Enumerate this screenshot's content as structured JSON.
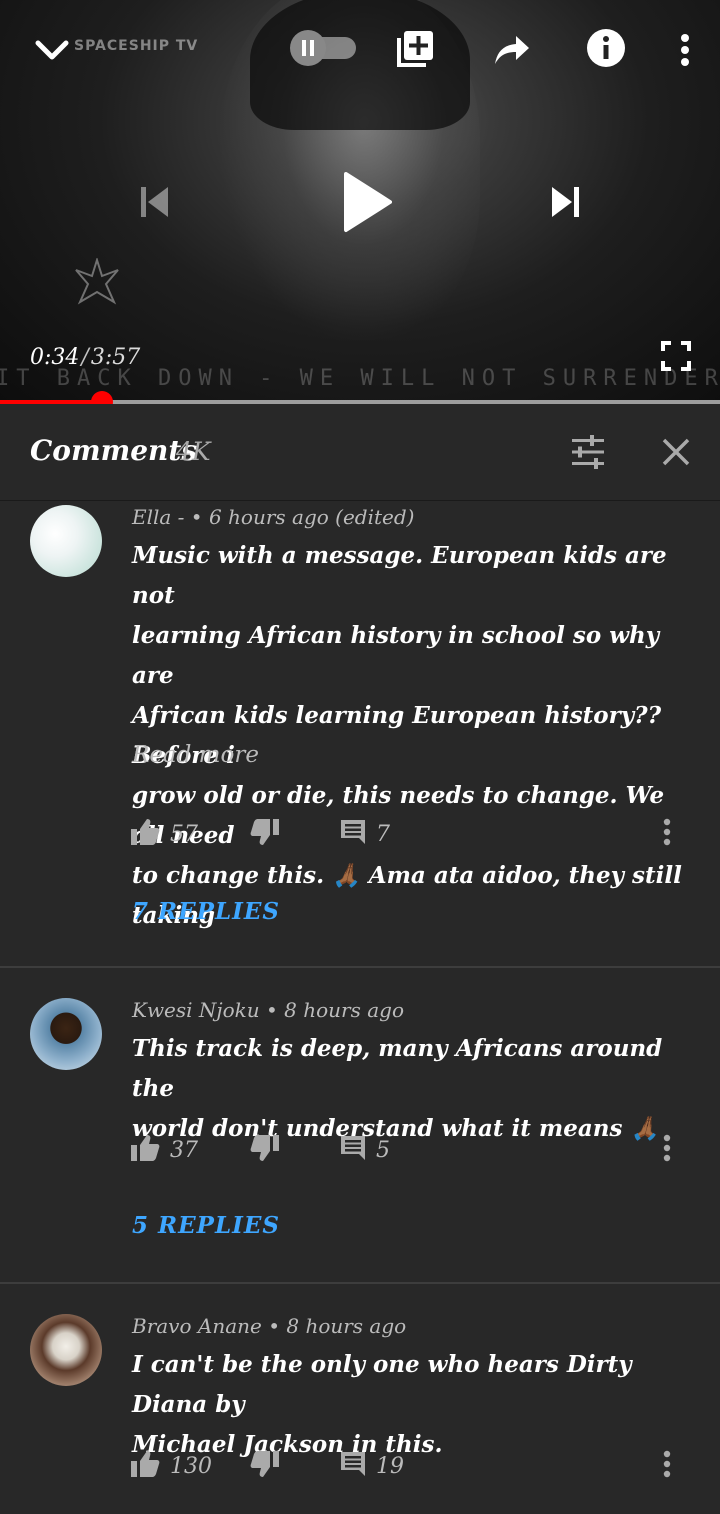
{
  "player": {
    "channel_watermark": "SPACESHIP TV",
    "banner_text": "IT BACK DOWN - WE WILL NOT SURRENDER. WE WILL NO",
    "current_time": "0:34",
    "separator": "/",
    "duration": "3:57",
    "progress_fraction": 0.142,
    "autoplay_on": false,
    "icons": {
      "collapse": "chevron-down-icon",
      "autoplay": "pause-toggle-icon",
      "add_to_playlist": "playlist-add-icon",
      "share": "share-icon",
      "info": "info-icon",
      "more": "more-vert-icon",
      "previous": "skip-previous-icon",
      "play": "play-icon",
      "next": "skip-next-icon",
      "fullscreen": "fullscreen-icon"
    }
  },
  "comments_panel": {
    "title": "Comments",
    "count": "4K",
    "icons": {
      "filter": "sort-sliders-icon",
      "close": "close-icon"
    }
  },
  "comments": [
    {
      "author": "Ella -",
      "time": "6 hours ago",
      "edited": "(edited)",
      "text_lines": [
        "Music with a message. European kids are not",
        "learning African history in school so why are",
        "African kids learning European history?? Before i",
        "grow old or die, this needs to change. We all need",
        "to change this. 🙏🏾 Ama ata aidoo, they still taking"
      ],
      "read_more": "Read more",
      "likes": "57",
      "reply_count": "7",
      "replies_label": "7 REPLIES"
    },
    {
      "author": "Kwesi Njoku",
      "time": "8 hours ago",
      "text_lines": [
        "This track is deep, many Africans around the",
        "world don't understand what it means 🙏🏾"
      ],
      "likes": "37",
      "reply_count": "5",
      "replies_label": "5 REPLIES"
    },
    {
      "author": "Bravo Anane",
      "time": "8 hours ago",
      "text_lines": [
        "I can't be the only one who hears Dirty Diana by",
        "Michael Jackson in this."
      ],
      "likes": "130",
      "reply_count": "19"
    }
  ],
  "colors": {
    "background": "#282828",
    "progress": "#ff0000",
    "replies_link": "#3ea6ff"
  }
}
